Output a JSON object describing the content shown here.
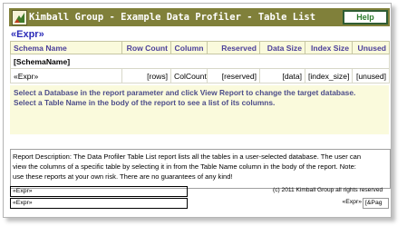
{
  "title": "Kimball Group - Example Data Profiler - Table List",
  "help_label": "Help",
  "expr_heading": "«Expr»",
  "columns": [
    "Schema Name",
    "Row Count",
    "Column",
    "Reserved",
    "Data Size",
    "Index Size",
    "Unused"
  ],
  "group_row": "[SchemaName]",
  "detail_row": [
    "«Expr»",
    "[rows]",
    "ColCount]",
    "[reserved]",
    "[data]",
    "[index_size]",
    "[unused]"
  ],
  "instructions": [
    "Select a Database in the report parameter and click View Report to change the target database.",
    "Select a Table Name in the body of the report to see a list of its columns."
  ],
  "description_lines": [
    "Report Description: The Data Profiler Table List report lists all the tables in a user-selected database.  The user can",
    "view the columns of a specific table by selecting it in from the Table Name column in the body of the report.  Note:",
    "use these reports at your own risk.  There are no guarantees of any kind!"
  ],
  "footer": {
    "expr_1": "«Expr»",
    "expr_2": "«Expr»",
    "copyright": "(c) 2011 Kimball Group all rights reserved",
    "expr_3": "«Expr»",
    "page": "[&Pag"
  },
  "colors": {
    "title_bar": "#80803a",
    "header_bg": "#fafadc",
    "accent_blue": "#2b2bb8",
    "help_border": "#2f5d34"
  }
}
